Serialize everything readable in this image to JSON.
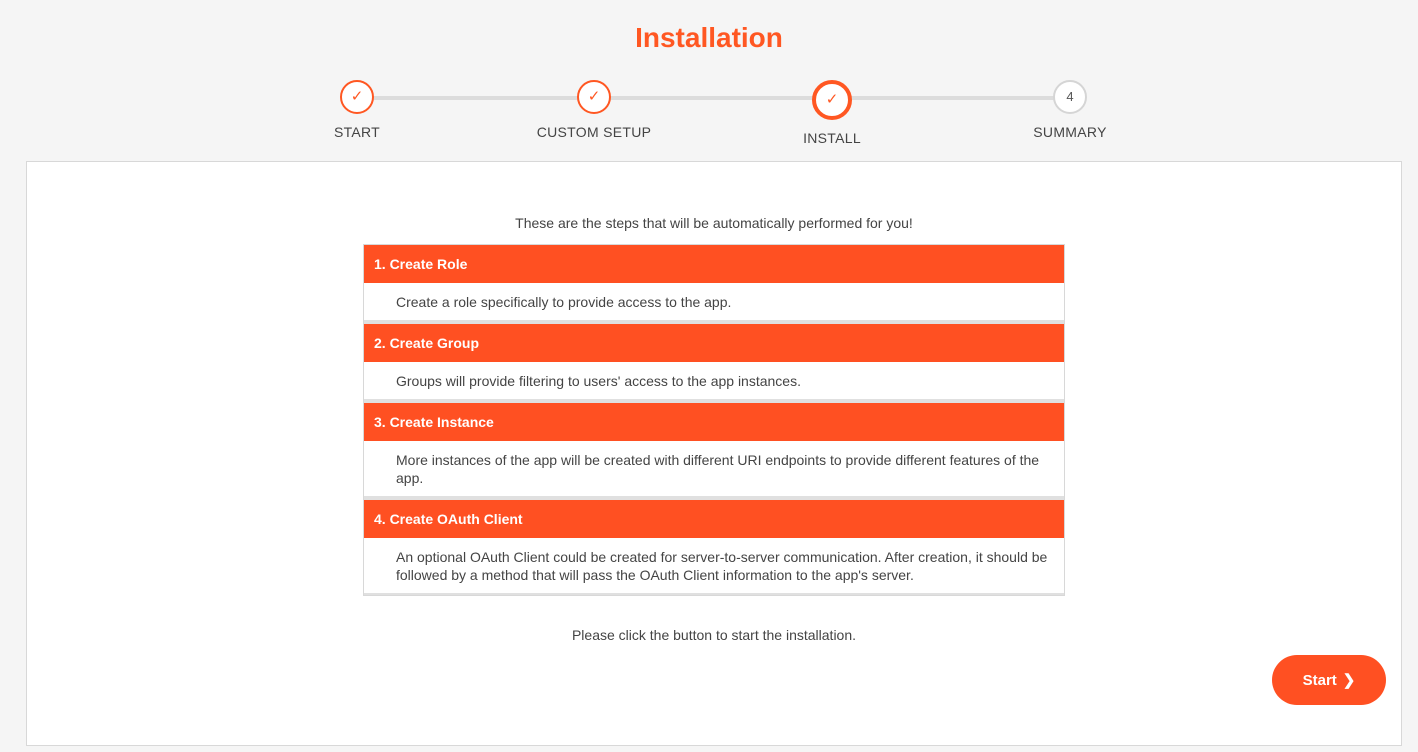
{
  "header": {
    "title": "Installation"
  },
  "stepper": {
    "steps": [
      {
        "label": "START",
        "icon": "check-icon",
        "glyph": "✓",
        "state": "done"
      },
      {
        "label": "CUSTOM SETUP",
        "icon": "check-icon",
        "glyph": "✓",
        "state": "done"
      },
      {
        "label": "INSTALL",
        "icon": "check-icon",
        "glyph": "✓",
        "state": "active"
      },
      {
        "label": "SUMMARY",
        "glyph": "4",
        "state": "pending"
      }
    ]
  },
  "main": {
    "intro": "These are the steps that will be automatically performed for you!",
    "items": [
      {
        "title": "1. Create Role",
        "description": "Create a role specifically to provide access to the app."
      },
      {
        "title": "2. Create Group",
        "description": "Groups will provide filtering to users' access to the app instances."
      },
      {
        "title": "3. Create Instance",
        "description": "More instances of the app will be created with different URI endpoints to provide different features of the app."
      },
      {
        "title": "4. Create OAuth Client",
        "description": "An optional OAuth Client could be created for server-to-server communication. After creation, it should be followed by a method that will pass the OAuth Client information to the app's server."
      }
    ],
    "outro": "Please click the button to start the installation.",
    "start_label": "Start",
    "start_icon": "chevron-right-icon",
    "start_glyph": "❯"
  },
  "colors": {
    "accent": "#ff5722",
    "header_bg": "#ff5022",
    "track": "#dcdcdc"
  }
}
